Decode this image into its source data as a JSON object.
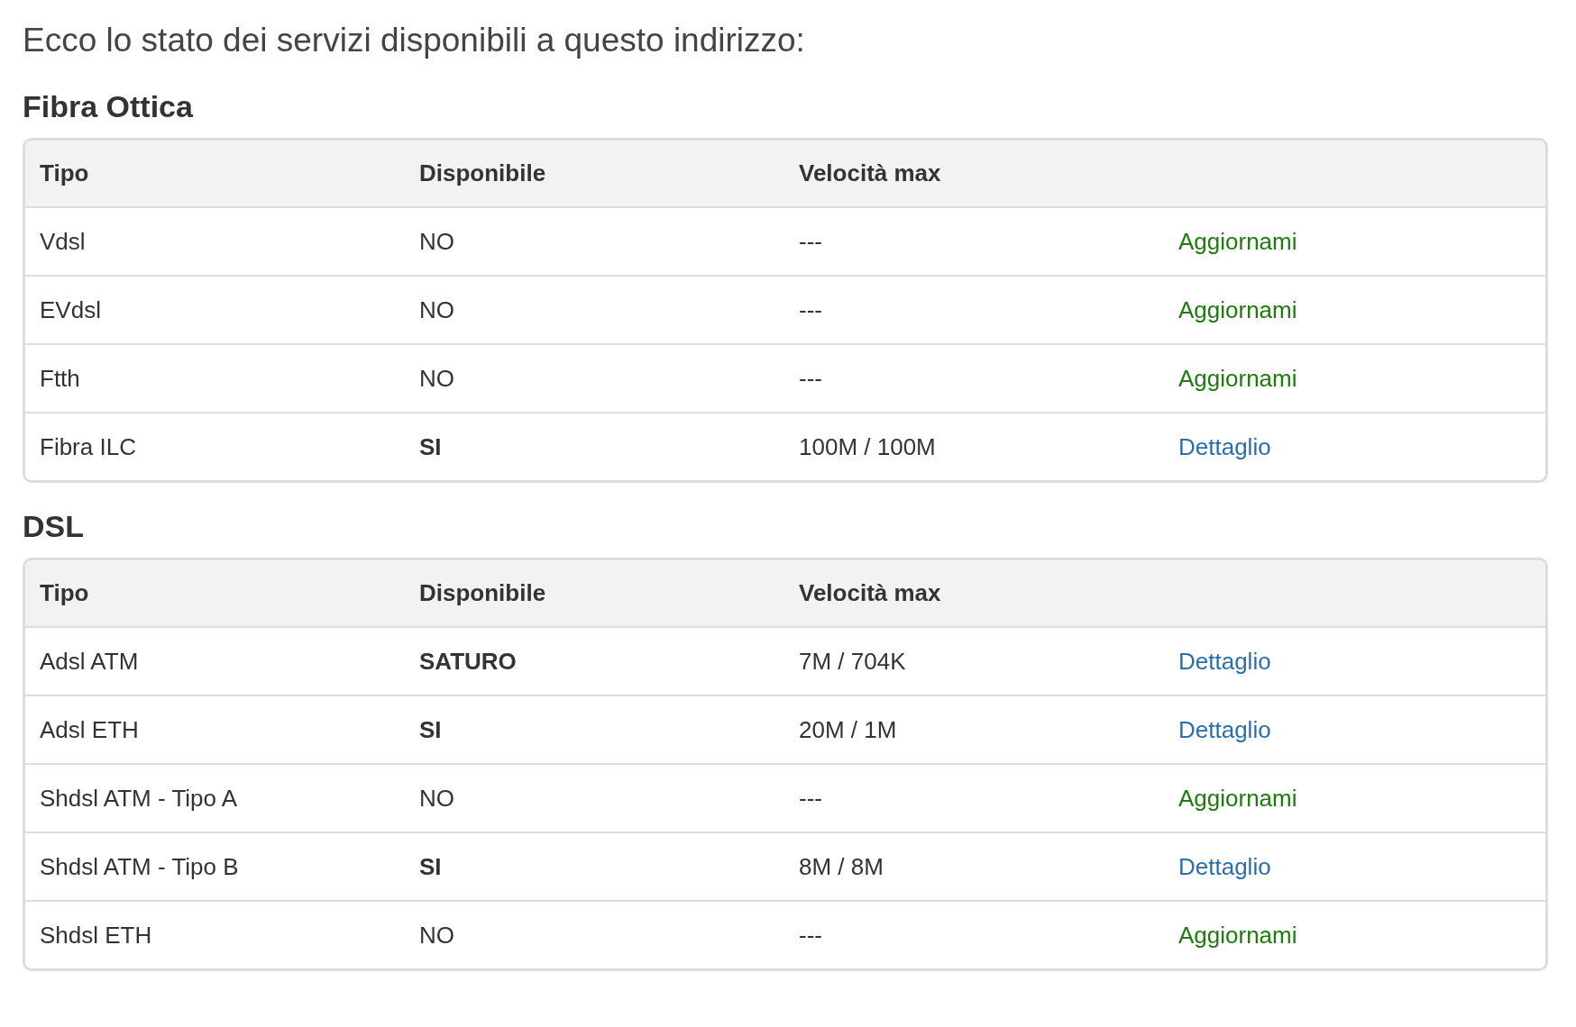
{
  "intro": "Ecco lo stato dei servizi disponibili a questo indirizzo:",
  "sections": [
    {
      "title": "Fibra Ottica",
      "columns": [
        "Tipo",
        "Disponibile",
        "Velocità max"
      ],
      "rows": [
        {
          "type": "Vdsl",
          "available": "NO",
          "bold": false,
          "speed": "---",
          "action": {
            "label": "Aggiornami",
            "kind": "upgrade"
          }
        },
        {
          "type": "EVdsl",
          "available": "NO",
          "bold": false,
          "speed": "---",
          "action": {
            "label": "Aggiornami",
            "kind": "upgrade"
          }
        },
        {
          "type": "Ftth",
          "available": "NO",
          "bold": false,
          "speed": "---",
          "action": {
            "label": "Aggiornami",
            "kind": "upgrade"
          }
        },
        {
          "type": "Fibra ILC",
          "available": "SI",
          "bold": true,
          "speed": "100M / 100M",
          "action": {
            "label": "Dettaglio",
            "kind": "detail"
          }
        }
      ]
    },
    {
      "title": "DSL",
      "columns": [
        "Tipo",
        "Disponibile",
        "Velocità max"
      ],
      "rows": [
        {
          "type": "Adsl ATM",
          "available": "SATURO",
          "bold": true,
          "speed": "7M / 704K",
          "action": {
            "label": "Dettaglio",
            "kind": "detail"
          }
        },
        {
          "type": "Adsl ETH",
          "available": "SI",
          "bold": true,
          "speed": "20M / 1M",
          "action": {
            "label": "Dettaglio",
            "kind": "detail"
          }
        },
        {
          "type": "Shdsl ATM - Tipo A",
          "available": "NO",
          "bold": false,
          "speed": "---",
          "action": {
            "label": "Aggiornami",
            "kind": "upgrade"
          }
        },
        {
          "type": "Shdsl ATM - Tipo B",
          "available": "SI",
          "bold": true,
          "speed": "8M / 8M",
          "action": {
            "label": "Dettaglio",
            "kind": "detail"
          }
        },
        {
          "type": "Shdsl ETH",
          "available": "NO",
          "bold": false,
          "speed": "---",
          "action": {
            "label": "Aggiornami",
            "kind": "upgrade"
          }
        }
      ]
    }
  ]
}
